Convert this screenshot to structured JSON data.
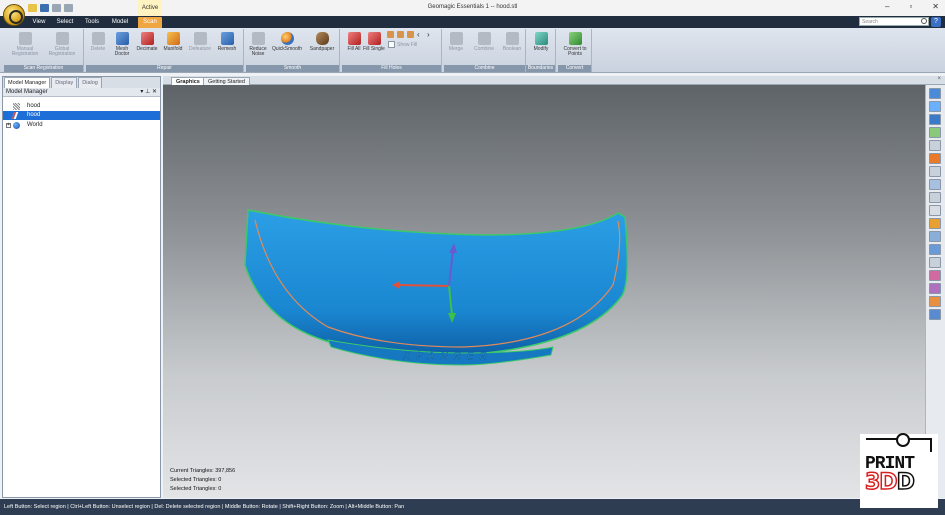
{
  "window": {
    "title": "Geomagic Essentials 1 -- hood.stl",
    "active_context": "Active",
    "controls": [
      "–",
      "▫",
      "✕"
    ]
  },
  "ribbon_tabs": [
    "View",
    "Select",
    "Tools",
    "Model",
    "Scan"
  ],
  "active_tab": "Scan",
  "search": {
    "placeholder": "Search"
  },
  "help_label": "?",
  "ribbon": {
    "groups": [
      {
        "label": "Scan Registration",
        "buttons": [
          "Manual Registration",
          "Global Registration"
        ]
      },
      {
        "label": "Repair",
        "buttons": [
          "Delete",
          "Mesh Doctor",
          "Decimate",
          "Manifold",
          "Defeature",
          "Remesh"
        ]
      },
      {
        "label": "Smooth",
        "buttons": [
          "Reduce Noise",
          "QuickSmooth",
          "Sandpaper"
        ]
      },
      {
        "label": "Fill Holes",
        "buttons": [
          "Fill All",
          "Fill Single"
        ],
        "option": "Show Fill"
      },
      {
        "label": "Combine",
        "buttons": [
          "Merge",
          "Combine",
          "Boolean"
        ]
      },
      {
        "label": "Boundaries",
        "buttons": [
          "Modify"
        ]
      },
      {
        "label": "Convert",
        "buttons": [
          "Convert to Points"
        ]
      }
    ]
  },
  "panel": {
    "tabs": [
      "Model Manager",
      "Display",
      "Dialog"
    ],
    "header": "Model Manager",
    "header_controls": "▾ ⊥ ✕",
    "tree": [
      {
        "label": "hood",
        "type": "points"
      },
      {
        "label": "hood",
        "type": "mesh",
        "selected": true
      },
      {
        "label": "World",
        "type": "world",
        "expander": "+"
      }
    ]
  },
  "graphics_tabs": [
    "Graphics",
    "Getting Started"
  ],
  "graphics_close": "×",
  "model_text": "XPANRER",
  "stats": {
    "current_triangles": "Current Triangles: 397,856",
    "selected_triangles_1": "Selected Triangles: 0",
    "selected_triangles_2": "Selected Triangles: 0"
  },
  "status_bar": "Left Button: Select region | Ctrl+Left Button: Unselect region | Del: Delete selected region | Middle Button: Rotate | Shift+Right Button: Zoom | Alt+Middle Button: Pan",
  "watermark": {
    "line1": "PRINT",
    "line2a": "3D",
    "line2b": "D"
  },
  "colors": {
    "mesh": "#1a90d8",
    "mesh_edge": "#3bc96a",
    "accent_tab": "#f0a640",
    "axis_x": "#e0503a",
    "axis_y": "#6a5ad0",
    "axis_z": "#3cc04a"
  }
}
